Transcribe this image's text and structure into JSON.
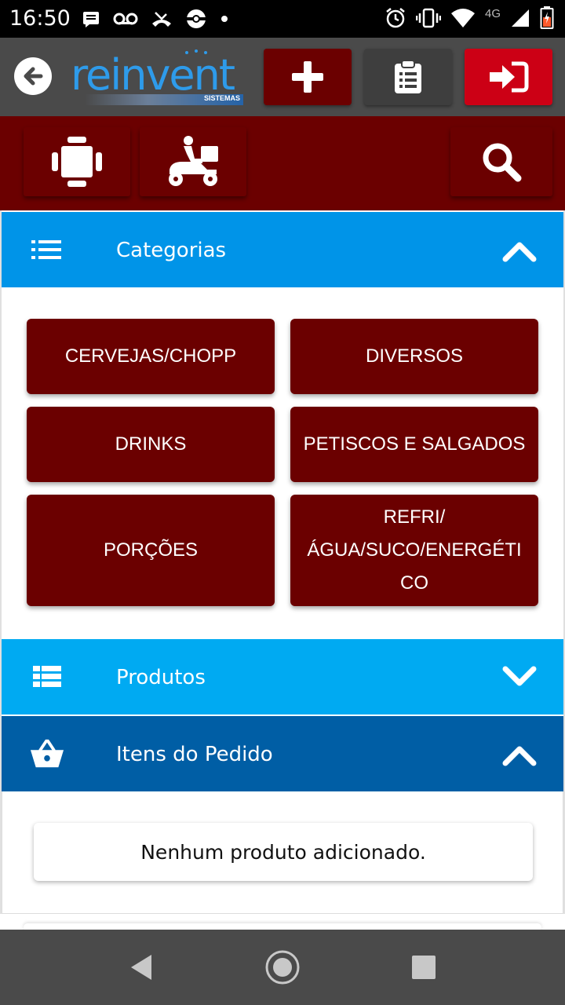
{
  "status_bar": {
    "time": "16:50",
    "network": "4G",
    "left_icons": [
      "message-icon",
      "voicemail-icon",
      "missed-call-icon",
      "pokeball-icon",
      "dot-icon"
    ],
    "right_icons": [
      "alarm-icon",
      "vibrate-icon",
      "wifi-icon",
      "signal-icon",
      "battery-icon"
    ]
  },
  "header": {
    "logo_text": "reinvent",
    "logo_subtext": "SISTEMAS",
    "buttons": [
      "add-icon",
      "clipboard-icon",
      "sign-in-icon"
    ],
    "colors": {
      "header_bg": "#4a4a4a",
      "add_bg": "#6b0000",
      "clipboard_bg": "#3e3e3e",
      "exit_bg": "#cc0015"
    }
  },
  "toolbar": {
    "buttons": [
      "table-icon",
      "delivery-scooter-icon",
      "search-icon"
    ],
    "bg": "#6b0000"
  },
  "categorias": {
    "title": "Categorias",
    "expanded": true,
    "bg": "#0094e8",
    "items": [
      "CERVEJAS/CHOPP",
      "DIVERSOS",
      "DRINKS",
      "PETISCOS E SALGADOS",
      "PORÇÕES",
      "REFRI/\nÁGUA/SUCO/ENERGÉTI\nCO"
    ]
  },
  "produtos": {
    "title": "Produtos",
    "expanded": false,
    "bg": "#00aaf2"
  },
  "itens": {
    "title": "Itens do Pedido",
    "expanded": true,
    "bg": "#005ea5",
    "empty_message": "Nenhum produto adicionado."
  },
  "nav": [
    "back-triangle-icon",
    "home-circle-icon",
    "recents-square-icon"
  ]
}
